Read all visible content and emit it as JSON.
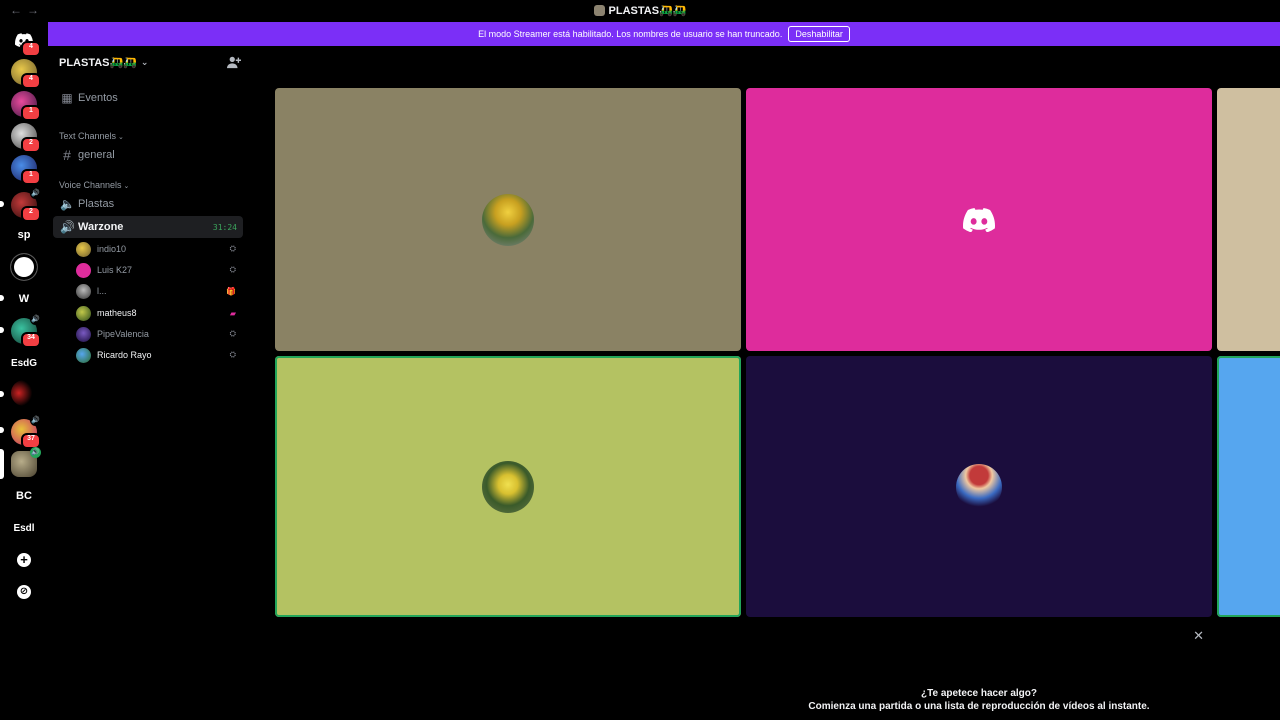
{
  "titlebar": {
    "title": "PLASTAS🛺🛺",
    "back": "←",
    "forward": "→"
  },
  "banner": {
    "text": "El modo Streamer está habilitado. Los nombres de usuario se han truncado.",
    "button": "Deshabilitar"
  },
  "rail": {
    "items": [
      {
        "label": "",
        "badge": "4"
      },
      {
        "label": "",
        "badge": "4"
      },
      {
        "label": "",
        "badge": "1"
      },
      {
        "label": "",
        "badge": "2"
      },
      {
        "label": "",
        "badge": "1"
      },
      {
        "label": "",
        "badge": "2"
      },
      {
        "label": "sp",
        "badge": ""
      },
      {
        "label": "",
        "badge": ""
      },
      {
        "label": "W",
        "badge": ""
      },
      {
        "label": "",
        "badge": "34"
      },
      {
        "label": "EsdG",
        "badge": ""
      },
      {
        "label": "",
        "badge": ""
      },
      {
        "label": "",
        "badge": "37"
      },
      {
        "label": "",
        "badge": ""
      },
      {
        "label": "BC",
        "badge": ""
      },
      {
        "label": "Esdl",
        "badge": ""
      }
    ],
    "add": "+",
    "explore": "⊘"
  },
  "server": {
    "name": "PLASTAS🛺🛺"
  },
  "sidebar": {
    "events": "Eventos",
    "text_category": "Text Channels",
    "text_channels": [
      "general"
    ],
    "voice_category": "Voice Channels",
    "voice_channels": [
      {
        "name": "Plastas"
      },
      {
        "name": "Warzone",
        "timer": "31:24"
      }
    ],
    "voice_users": [
      {
        "name": "indio10",
        "device": "⛭"
      },
      {
        "name": "Luis K27",
        "device": "⛭"
      },
      {
        "name": "l...",
        "device": "🎁"
      },
      {
        "name": "matheus8",
        "device": "▰"
      },
      {
        "name": "PipeValencia",
        "device": "⛭"
      },
      {
        "name": "Ricardo Rayo",
        "device": "⛭"
      }
    ]
  },
  "tiles": [
    {
      "bg": "#8a8264",
      "content": "avatar",
      "speaking": false
    },
    {
      "bg": "#de2c9c",
      "content": "discord",
      "speaking": false
    },
    {
      "bg": "#cfbfa0",
      "content": "none",
      "speaking": false
    },
    {
      "bg": "#b4c262",
      "content": "avatar",
      "speaking": true
    },
    {
      "bg": "#1b0d3d",
      "content": "avatar",
      "speaking": false
    },
    {
      "bg": "#56a6ef",
      "content": "none",
      "speaking": true
    }
  ],
  "activity": {
    "title": "¿Te apetece hacer algo?",
    "subtitle": "Comienza una partida o una lista de reproducción de vídeos al instante."
  }
}
